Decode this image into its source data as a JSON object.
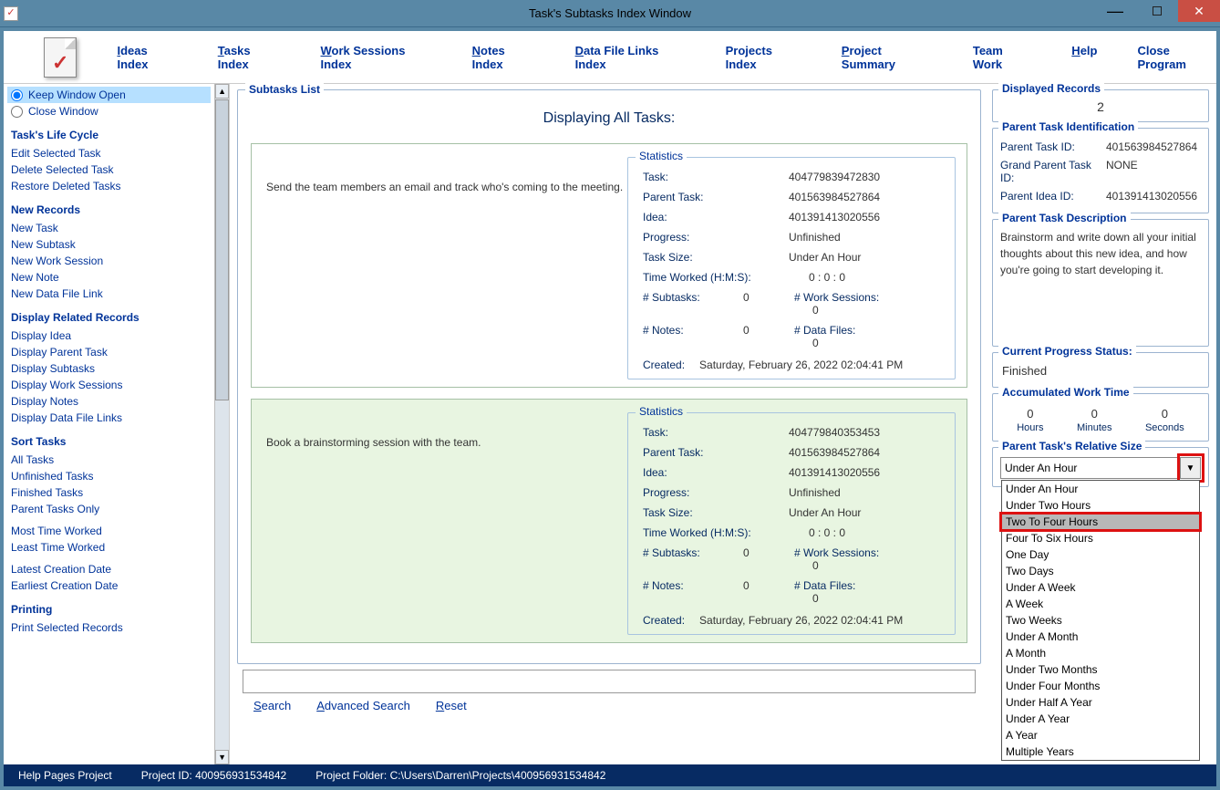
{
  "window": {
    "title": "Task's Subtasks Index Window"
  },
  "menu": {
    "ideas": "deas Index",
    "tasks": "asks Index",
    "work": "ork Sessions Index",
    "notes": "otes Index",
    "files": "ata File Links Index",
    "projects": "Projects Index",
    "summary": "roject Summary",
    "team": "Team Work",
    "help": "elp",
    "close": "Close Program"
  },
  "sidebar": {
    "keep_open": "Keep Window Open",
    "close_window": "Close Window",
    "life_cycle_head": "Task's Life Cycle",
    "edit_task": "Edit Selected Task",
    "delete_task": "Delete Selected Task",
    "restore_tasks": "Restore Deleted Tasks",
    "new_records_head": "New Records",
    "new_task": "New Task",
    "new_subtask": "New Subtask",
    "new_work_session": "New Work Session",
    "new_note": "New Note",
    "new_file_link": "New Data File Link",
    "display_head": "Display Related Records",
    "display_idea": "Display Idea",
    "display_parent": "Display Parent Task",
    "display_subtasks": "Display Subtasks",
    "display_ws": "Display Work Sessions",
    "display_notes": "Display Notes",
    "display_files": "Display Data File Links",
    "sort_head": "Sort Tasks",
    "all_tasks": "All Tasks",
    "unfinished": "Unfinished Tasks",
    "finished": "Finished Tasks",
    "parent_only": "Parent Tasks Only",
    "most_worked": "Most Time Worked",
    "least_worked": "Least Time Worked",
    "latest_date": "Latest Creation Date",
    "earliest_date": "Earliest Creation Date",
    "printing_head": "Printing",
    "print_selected": "Print Selected Records"
  },
  "subtasks_legend": "Subtasks List",
  "display_heading": "Displaying All Tasks:",
  "stats_legend": "Statistics",
  "tasks": [
    {
      "desc": "Send the team members an email and track who's coming to the meeting.",
      "task": "404779839472830",
      "parent": "401563984527864",
      "idea": "401391413020556",
      "progress": "Unfinished",
      "size": "Under An Hour",
      "time_worked": "0  :  0  :  0",
      "n_subtasks": "0",
      "n_work_sessions": "0",
      "n_notes": "0",
      "n_files": "0",
      "created": "Saturday, February 26, 2022   02:04:41 PM"
    },
    {
      "desc": "Book a brainstorming session with the team.",
      "task": "404779840353453",
      "parent": "401563984527864",
      "idea": "401391413020556",
      "progress": "Unfinished",
      "size": "Under An Hour",
      "time_worked": "0  :  0  :  0",
      "n_subtasks": "0",
      "n_work_sessions": "0",
      "n_notes": "0",
      "n_files": "0",
      "created": "Saturday, February 26, 2022   02:04:41 PM"
    }
  ],
  "stat_labels": {
    "task": "Task:",
    "parent": "Parent Task:",
    "idea": "Idea:",
    "progress": "Progress:",
    "size": "Task Size:",
    "time_worked": "Time Worked (H:M:S):",
    "n_subtasks": "# Subtasks:",
    "n_work_sessions": "# Work Sessions:",
    "n_notes": "# Notes:",
    "n_files": "# Data Files:",
    "created": "Created:"
  },
  "search": {
    "search": "earch",
    "advanced": "dvanced Search",
    "reset": "eset"
  },
  "right": {
    "displayed_legend": "Displayed Records",
    "displayed_count": "2",
    "parent_id_legend": "Parent Task Identification",
    "parent_task_id_lbl": "Parent Task ID:",
    "parent_task_id": "401563984527864",
    "grand_parent_lbl": "Grand Parent Task ID:",
    "grand_parent": "NONE",
    "parent_idea_lbl": "Parent Idea ID:",
    "parent_idea": "401391413020556",
    "desc_legend": "Parent Task Description",
    "desc_text": "Brainstorm and write down all your initial thoughts about this new idea, and how you're going to start developing it.",
    "cps_legend": "Current Progress Status:",
    "cps_val": "Finished",
    "awt_legend": "Accumulated Work Time",
    "awt_hours": "0",
    "awt_min": "0",
    "awt_sec": "0",
    "awt_h_lbl": "Hours",
    "awt_m_lbl": "Minutes",
    "awt_s_lbl": "Seconds",
    "size_legend": "Parent Task's Relative Size",
    "size_selected": "Under An Hour",
    "size_options": [
      "Under An Hour",
      "Under Two Hours",
      "Two To Four Hours",
      "Four To Six Hours",
      "One Day",
      "Two Days",
      "Under A Week",
      "A Week",
      "Two Weeks",
      "Under A Month",
      "A Month",
      "Under Two Months",
      "Under Four Months",
      "Under Half A Year",
      "Under A Year",
      "A Year",
      "Multiple Years"
    ]
  },
  "status": {
    "help_project": "Help Pages Project",
    "project_id": "Project ID:  400956931534842",
    "project_folder": "Project Folder:  C:\\Users\\Darren\\Projects\\400956931534842"
  }
}
